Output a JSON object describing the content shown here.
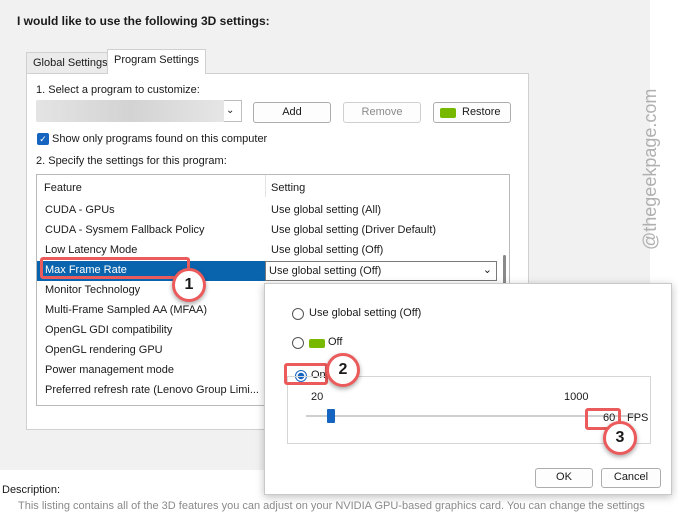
{
  "heading": "I would like to use the following 3D settings:",
  "tabs": [
    {
      "label": "Global Settings",
      "active": false
    },
    {
      "label": "Program Settings",
      "active": true
    }
  ],
  "select_program_label": "1. Select a program to customize:",
  "buttons": {
    "add": "Add",
    "remove": "Remove",
    "restore": "Restore"
  },
  "show_only_found": {
    "label": "Show only programs found on this computer",
    "checked": true
  },
  "specify_label": "2. Specify the settings for this program:",
  "table": {
    "columns": [
      "Feature",
      "Setting"
    ],
    "rows": [
      {
        "feature": "CUDA - GPUs",
        "setting": "Use global setting (All)"
      },
      {
        "feature": "CUDA - Sysmem Fallback Policy",
        "setting": "Use global setting (Driver Default)"
      },
      {
        "feature": "Low Latency Mode",
        "setting": "Use global setting (Off)"
      },
      {
        "feature": "Max Frame Rate",
        "setting": "Use global setting (Off)",
        "selected": true
      },
      {
        "feature": "Monitor Technology",
        "setting": ""
      },
      {
        "feature": "Multi-Frame Sampled AA (MFAA)",
        "setting": ""
      },
      {
        "feature": "OpenGL GDI compatibility",
        "setting": ""
      },
      {
        "feature": "OpenGL rendering GPU",
        "setting": ""
      },
      {
        "feature": "Power management mode",
        "setting": ""
      },
      {
        "feature": "Preferred refresh rate (Lenovo Group Limi...",
        "setting": ""
      }
    ]
  },
  "popup": {
    "options": {
      "global": "Use global setting (Off)",
      "off": "Off",
      "on": "On"
    },
    "selected": "on",
    "slider": {
      "min_label": "20",
      "max_label": "1000",
      "value": "60",
      "unit": "FPS",
      "min": 20,
      "max": 1000,
      "current": 60
    },
    "ok": "OK",
    "cancel": "Cancel"
  },
  "callouts": [
    "1",
    "2",
    "3"
  ],
  "description_label": "Description:",
  "description_text": "This listing contains all of the 3D features you can adjust on your NVIDIA GPU-based graphics card. You can change the settings",
  "watermark": "@thegeekpage.com",
  "colors": {
    "selection": "#0a64ad",
    "accent": "#1565c0",
    "annotation": "#ec5b5b",
    "nvidia": "#76b900"
  }
}
